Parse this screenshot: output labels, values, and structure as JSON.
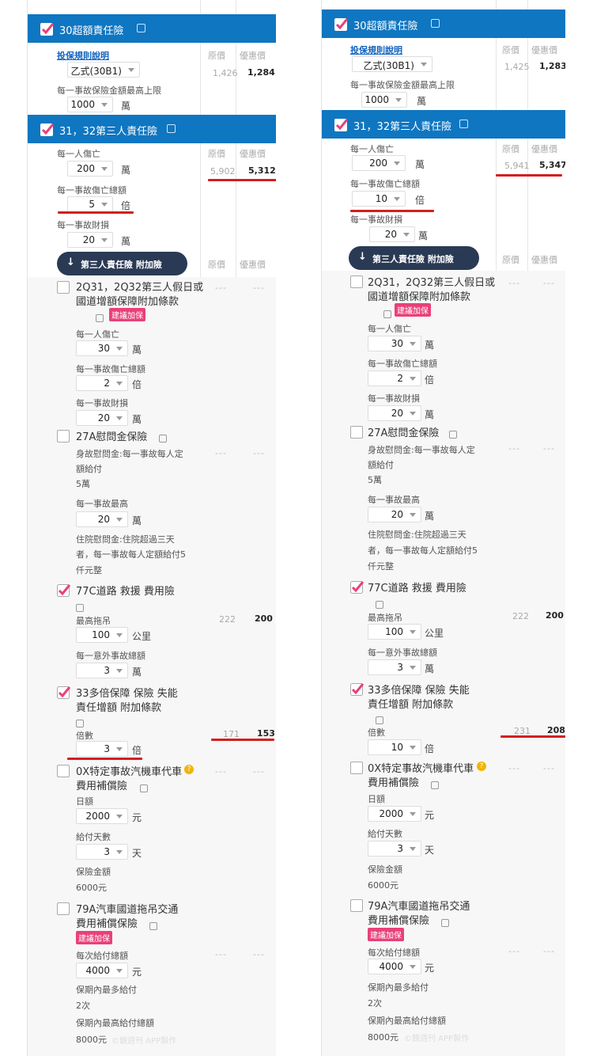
{
  "common": {
    "rule_link": "投保規則說明",
    "plan_value": "乙式(30B1)",
    "max_limit_label": "每一事故保險金額最高上限",
    "max_limit_value": "1000",
    "unit_wan": "萬",
    "unit_bei": "倍",
    "unit_yuan": "元",
    "unit_tian": "天",
    "unit_km": "公里",
    "col_original": "原價",
    "col_discount": "優惠價",
    "sec30_title": "30超額責任險",
    "sec31_title": "31，32第三人責任險",
    "per_person_death": "每一人傷亡",
    "per_accident_death_total": "每一事故傷亡總額",
    "per_accident_property": "每一事故財損",
    "addon_pill": "第三人責任險 附加險",
    "item_2q_title_1": "2Q31，2Q32第三人假日或",
    "item_2q_title_2": "國道增額保障附加條款",
    "suggest_tag": "建議加保",
    "item_27a_title": "27A慰問金保險",
    "item_27a_desc_1": "身故慰問金:每一事故每人定",
    "item_27a_desc_2": "額給付",
    "item_27a_desc_3": "5萬",
    "per_accident_max": "每一事故最高",
    "hosp_1": "住院慰問金:住院超過三天",
    "hosp_2": "者，每一事故每人定額給付5",
    "hosp_3": "仟元整",
    "item_77c_title": "77C道路 救援 費用險",
    "max_tow": "最高拖吊",
    "per_accident_total": "每一意外事故總額",
    "item_33_title_1": "33多倍保障 保險 失能",
    "item_33_title_2": "責任增額 附加條款",
    "multiple": "倍數",
    "item_0x_title_1": "0X特定事故汽機車代車",
    "item_0x_title_2": "費用補償險",
    "daily": "日額",
    "pay_days": "給付天數",
    "insured_amount": "保險金額",
    "amount_6000": "6000元",
    "item_79a_title_1": "79A汽車國道拖吊交通",
    "item_79a_title_2": "費用補償保險",
    "per_pay_total": "每次給付總額",
    "period_max_pay": "保期內最多給付",
    "times_2": "2次",
    "period_max_total": "保期內最高給付總額",
    "amount_8000": "8000元",
    "watermark": "©鏡週刊 APP製作",
    "dash": "---"
  },
  "left": {
    "sec30_orig": "1,426",
    "sec30_disc": "1,284",
    "death_per_person": "200",
    "death_total": "5",
    "property": "20",
    "sec31_orig": "5,902",
    "sec31_disc": "5,312",
    "q2_person": "30",
    "q2_total": "2",
    "q2_property": "20",
    "a27_max": "20",
    "c77_tow": "100",
    "c77_total": "3",
    "c77_orig": "222",
    "c77_disc": "200",
    "m33_multiple": "3",
    "m33_orig": "171",
    "m33_disc": "153",
    "x0_daily": "2000",
    "x0_days": "3",
    "a79_total": "4000"
  },
  "right": {
    "sec30_orig": "1,425",
    "sec30_disc": "1,283",
    "death_per_person": "200",
    "death_total": "10",
    "property": "20",
    "sec31_orig": "5,941",
    "sec31_disc": "5,347",
    "q2_person": "30",
    "q2_total": "2",
    "q2_property": "20",
    "a27_max": "20",
    "c77_tow": "100",
    "c77_total": "3",
    "c77_orig": "222",
    "c77_disc": "200",
    "m33_multiple": "10",
    "m33_orig": "231",
    "m33_disc": "208",
    "x0_daily": "2000",
    "x0_days": "3",
    "a79_total": "4000"
  },
  "colors": {
    "header": "#0f76c1",
    "check": "#e9407a",
    "highlight": "#d31f1f",
    "pill": "#2a3a55"
  }
}
